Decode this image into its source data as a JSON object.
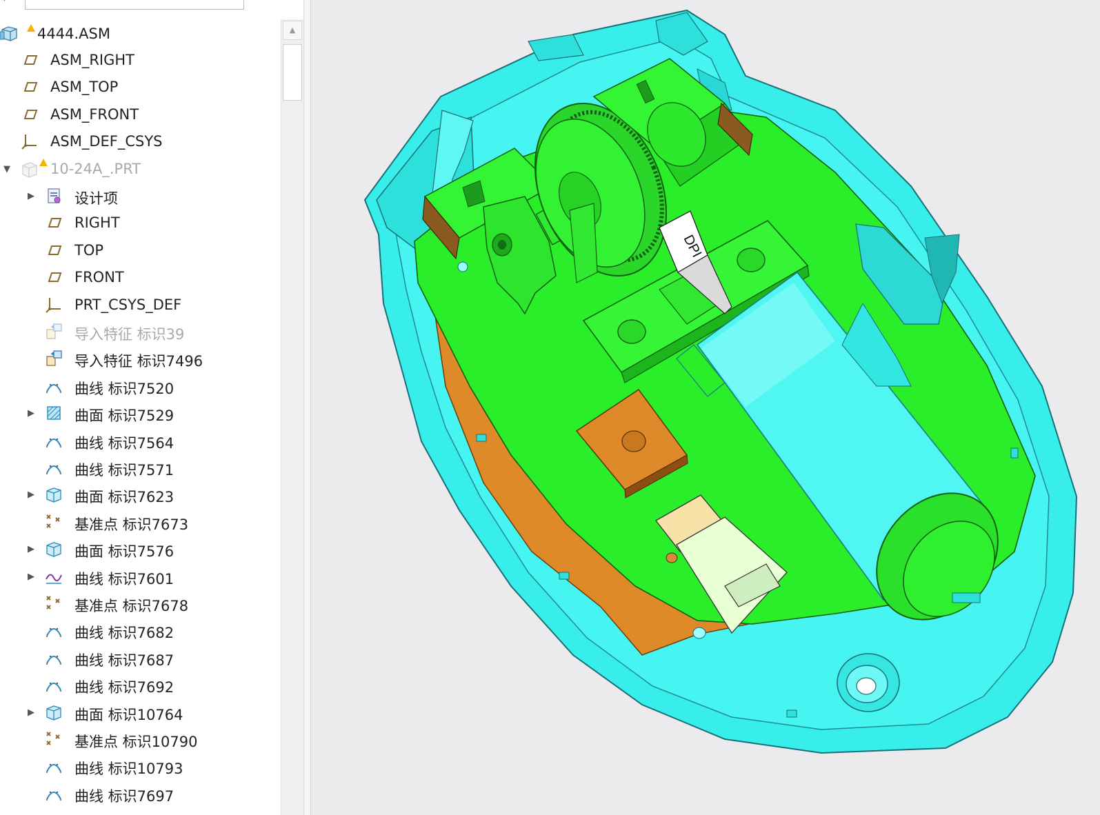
{
  "tree": {
    "root": {
      "label": "4444.ASM",
      "icon": "assembly-icon",
      "warning": true
    },
    "items": [
      {
        "label": "ASM_RIGHT",
        "icon": "datum-plane-icon",
        "level": 1,
        "expandable": false
      },
      {
        "label": "ASM_TOP",
        "icon": "datum-plane-icon",
        "level": 1,
        "expandable": false
      },
      {
        "label": "ASM_FRONT",
        "icon": "datum-plane-icon",
        "level": 1,
        "expandable": false
      },
      {
        "label": "ASM_DEF_CSYS",
        "icon": "csys-icon",
        "level": 1,
        "expandable": false
      },
      {
        "label": "10-24A_.PRT",
        "icon": "part-icon",
        "level": 1,
        "expandable": true,
        "expanded": true,
        "dimmed": true,
        "warning": true
      },
      {
        "label": "设计项",
        "icon": "design-items-icon",
        "level": 2,
        "expandable": true
      },
      {
        "label": "RIGHT",
        "icon": "datum-plane-icon",
        "level": 2,
        "expandable": false
      },
      {
        "label": "TOP",
        "icon": "datum-plane-icon",
        "level": 2,
        "expandable": false
      },
      {
        "label": "FRONT",
        "icon": "datum-plane-icon",
        "level": 2,
        "expandable": false
      },
      {
        "label": "PRT_CSYS_DEF",
        "icon": "csys-icon",
        "level": 2,
        "expandable": false
      },
      {
        "label": "导入特征 标识39",
        "icon": "import-feature-icon",
        "level": 2,
        "expandable": false,
        "dimmed": true
      },
      {
        "label": "导入特征 标识7496",
        "icon": "import-feature-icon",
        "level": 2,
        "expandable": false
      },
      {
        "label": "曲线 标识7520",
        "icon": "curve-icon",
        "level": 2,
        "expandable": false
      },
      {
        "label": "曲面 标识7529",
        "icon": "surface-icon",
        "level": 2,
        "expandable": true
      },
      {
        "label": "曲线 标识7564",
        "icon": "curve-icon",
        "level": 2,
        "expandable": false
      },
      {
        "label": "曲线 标识7571",
        "icon": "curve-icon",
        "level": 2,
        "expandable": false
      },
      {
        "label": "曲面 标识7623",
        "icon": "solid-surface-icon",
        "level": 2,
        "expandable": true
      },
      {
        "label": "基准点 标识7673",
        "icon": "datum-point-icon",
        "level": 2,
        "expandable": false
      },
      {
        "label": "曲面 标识7576",
        "icon": "solid-surface-icon",
        "level": 2,
        "expandable": true
      },
      {
        "label": "曲线 标识7601",
        "icon": "sketch-curve-icon",
        "level": 2,
        "expandable": true
      },
      {
        "label": "基准点 标识7678",
        "icon": "datum-point-icon",
        "level": 2,
        "expandable": false
      },
      {
        "label": "曲线 标识7682",
        "icon": "curve-icon",
        "level": 2,
        "expandable": false
      },
      {
        "label": "曲线 标识7687",
        "icon": "curve-icon",
        "level": 2,
        "expandable": false
      },
      {
        "label": "曲线 标识7692",
        "icon": "curve-icon",
        "level": 2,
        "expandable": false
      },
      {
        "label": "曲面 标识10764",
        "icon": "solid-surface-icon",
        "level": 2,
        "expandable": true
      },
      {
        "label": "基准点 标识10790",
        "icon": "datum-point-icon",
        "level": 2,
        "expandable": false
      },
      {
        "label": "曲线 标识10793",
        "icon": "curve-icon",
        "level": 2,
        "expandable": false
      },
      {
        "label": "曲线 标识7697",
        "icon": "curve-icon",
        "level": 2,
        "expandable": false
      }
    ]
  },
  "viewport": {
    "model_text": "DPI",
    "colors": {
      "shell": "#3ef2ee",
      "board": "#2bf02b",
      "copper": "#e08a2a",
      "battery": "#49f7f1",
      "background": "#ebebed"
    }
  }
}
